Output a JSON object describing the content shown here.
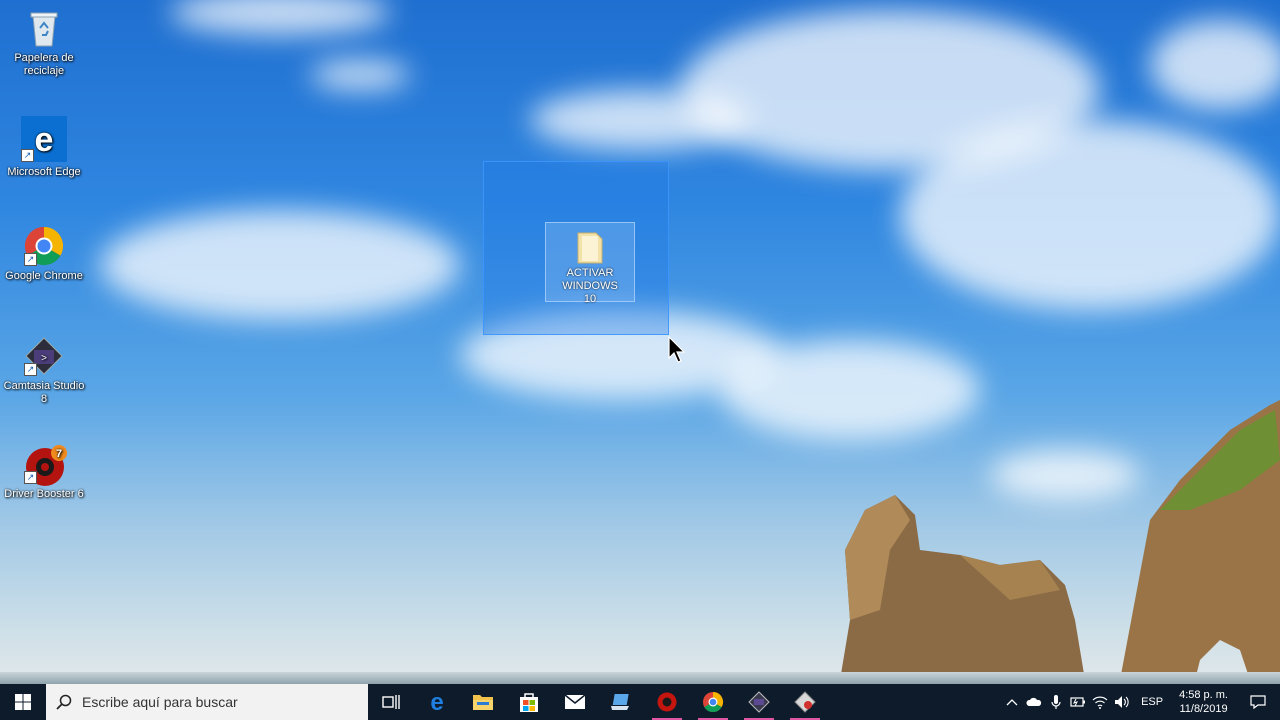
{
  "desktop": {
    "icons": [
      {
        "name": "Papelera de reciclaje"
      },
      {
        "name": "Microsoft Edge"
      },
      {
        "name": "Google Chrome"
      },
      {
        "name": "Camtasia Studio 8"
      },
      {
        "name": "Driver Booster 6"
      }
    ],
    "selected_folder": {
      "name": "ACTIVAR WINDOWS 10"
    }
  },
  "taskbar": {
    "search_placeholder": "Escribe aquí para buscar",
    "pinned": [
      "start",
      "task-view",
      "edge",
      "file-explorer",
      "store",
      "mail",
      "remote-app",
      "driver-booster",
      "chrome",
      "camtasia",
      "camtasia-recorder"
    ],
    "tray": {
      "language": "ESP",
      "time": "4:58 p. m.",
      "date": "11/8/2019"
    }
  },
  "colors": {
    "taskbar": "#0e1b2b",
    "selection": "#1e78e6",
    "running_indicator": "#e056a5"
  }
}
